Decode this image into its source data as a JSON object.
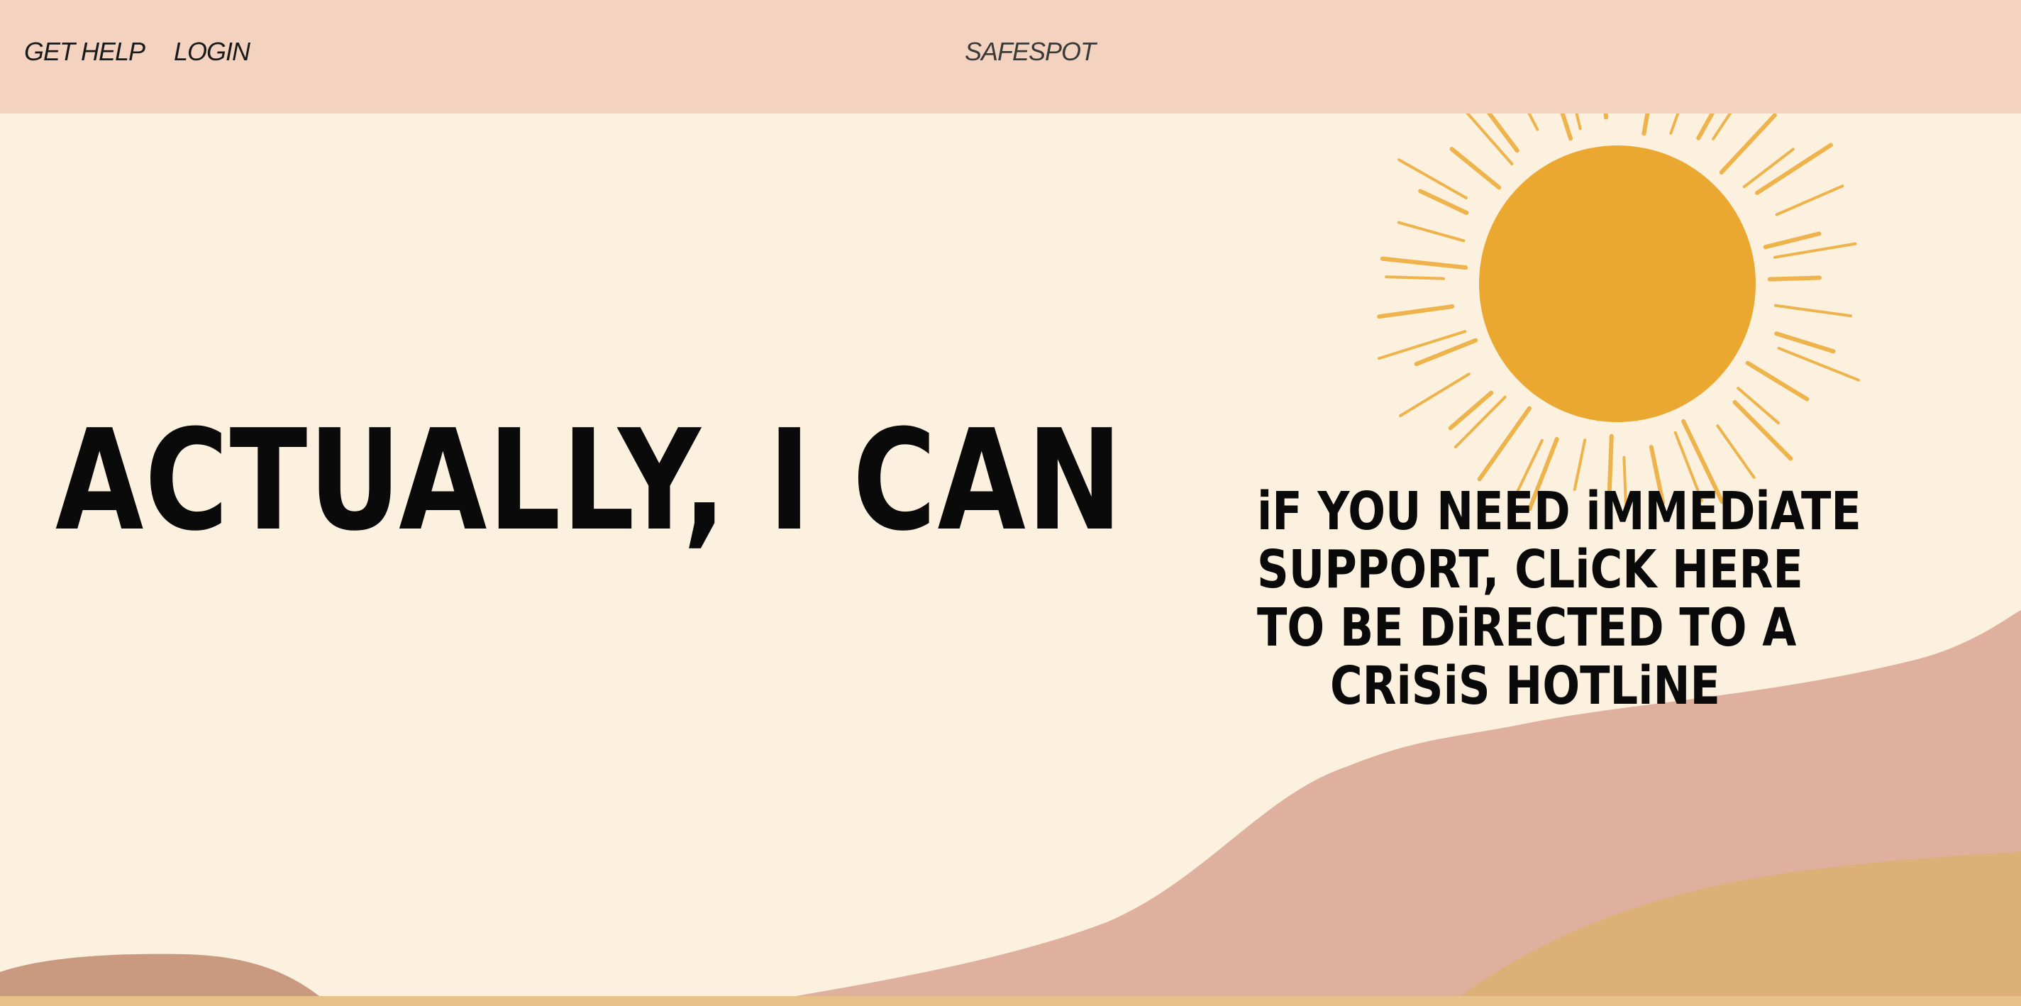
{
  "nav": {
    "get_help": "GET HELP",
    "login": "LOGIN",
    "brand": "SAFESPOT"
  },
  "hero": {
    "headline": "ACTUALLY, I CAN",
    "crisis_lines": [
      "iF YOU NEED iMMEDiATE",
      "SUPPORT, CLiCK HERE",
      "TO BE DiRECTED TO A",
      "CRiSiS HOTLiNE"
    ]
  },
  "footer": {
    "text": ""
  },
  "colors": {
    "nav_background": "#f3d3bf",
    "page_background": "#fcf0de",
    "sun": "#eba830",
    "hill_pink": "#e0b09e",
    "hill_sand": "#ddb077",
    "hill_brown": "#c99a80"
  },
  "icons": [
    "sun-illustration",
    "hills-illustration"
  ]
}
